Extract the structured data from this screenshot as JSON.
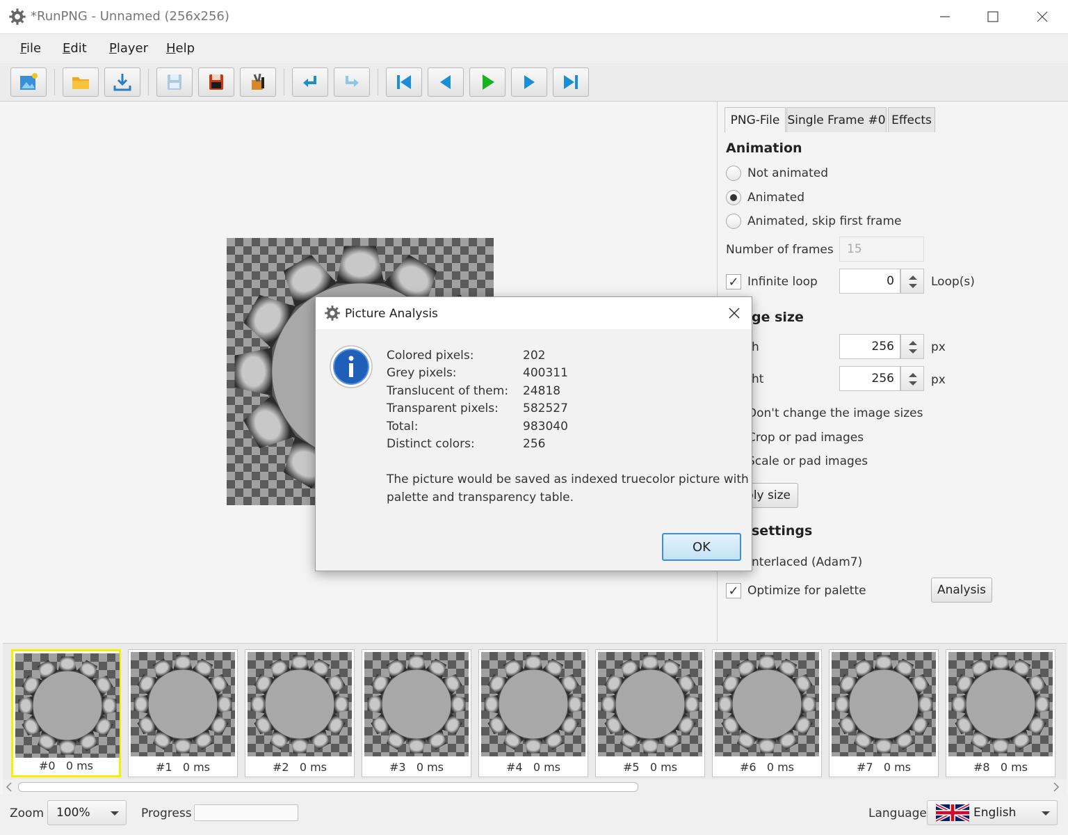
{
  "window": {
    "title": "*RunPNG - Unnamed (256x256)",
    "controls": [
      "minimize-icon",
      "maximize-icon",
      "close-icon"
    ]
  },
  "menu": [
    {
      "label": "File",
      "mnemonic": "F",
      "rest": "ile"
    },
    {
      "label": "Edit",
      "mnemonic": "E",
      "rest": "dit"
    },
    {
      "label": "Player",
      "mnemonic": "P",
      "rest": "layer"
    },
    {
      "label": "Help",
      "mnemonic": "H",
      "rest": "elp"
    }
  ],
  "toolbar": {
    "icons": [
      "new-image-icon",
      "open-folder-icon",
      "import-icon",
      "save-icon",
      "save-as-icon",
      "tools-icon",
      "undo-icon",
      "redo-icon",
      "first-frame-icon",
      "previous-frame-icon",
      "play-icon",
      "next-frame-icon",
      "last-frame-icon"
    ]
  },
  "panel": {
    "tabs": [
      "PNG-File",
      "Single Frame #0",
      "Effects"
    ],
    "animation": {
      "heading": "Animation",
      "options": [
        "Not animated",
        "Animated",
        "Animated, skip first frame"
      ],
      "selected": "Animated",
      "frames_label": "Number of frames",
      "frames_value": "15",
      "infinite_loop_label": "Infinite loop",
      "infinite_loop_checked": true,
      "loops_value": "0",
      "loops_label": "Loop(s)"
    },
    "image_size": {
      "heading_visible": "ge size",
      "width_label_visible": "h",
      "width_value": "256",
      "height_label_visible": "ht",
      "height_value": "256",
      "unit": "px",
      "options_visible": [
        "Don't change the image sizes",
        "Crop or pad images",
        "Scale or pad images"
      ],
      "apply_visible": "ply size"
    },
    "settings": {
      "heading_visible": "settings",
      "interlaced_visible": "nterlaced (Adam7)",
      "optimize_label": "Optimize for palette",
      "optimize_checked": true,
      "analysis_button": "Analysis"
    }
  },
  "dialog": {
    "title": "Picture Analysis",
    "icon": "info-icon",
    "rows": [
      {
        "key": "Colored pixels:",
        "value": "202"
      },
      {
        "key": "Grey pixels:",
        "value": "400311"
      },
      {
        "key": "Translucent of them:",
        "value": "24818"
      },
      {
        "key": "Transparent pixels:",
        "value": "582527"
      },
      {
        "key": "Total:",
        "value": "983040"
      },
      {
        "key": "Distinct colors:",
        "value": "256"
      }
    ],
    "message_line1": "The picture would be saved as indexed truecolor picture with",
    "message_line2": "palette and transparency table.",
    "ok": "OK"
  },
  "frames": [
    {
      "index": "#0",
      "time": "0 ms",
      "selected": true
    },
    {
      "index": "#1",
      "time": "0 ms"
    },
    {
      "index": "#2",
      "time": "0 ms"
    },
    {
      "index": "#3",
      "time": "0 ms"
    },
    {
      "index": "#4",
      "time": "0 ms"
    },
    {
      "index": "#5",
      "time": "0 ms"
    },
    {
      "index": "#6",
      "time": "0 ms"
    },
    {
      "index": "#7",
      "time": "0 ms"
    },
    {
      "index": "#8",
      "time": "0 ms"
    }
  ],
  "status": {
    "zoom_label": "Zoom",
    "zoom_value": "100%",
    "progress_label": "Progress",
    "progress_value": 0,
    "language_label": "Language",
    "language_value": "English"
  }
}
